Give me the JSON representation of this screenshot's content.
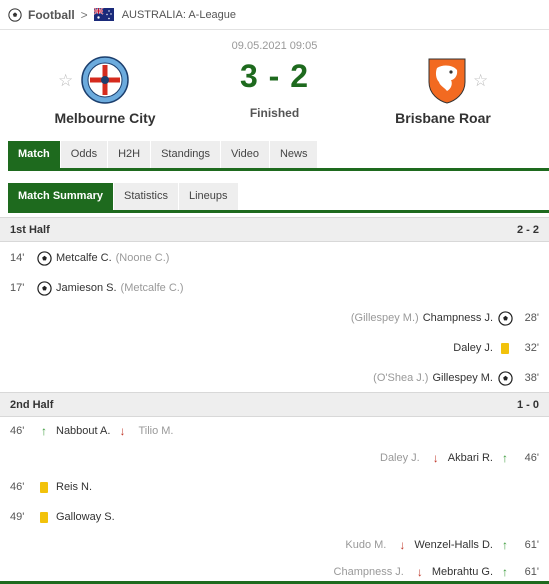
{
  "breadcrumb": {
    "sport": "Football",
    "separator": ">",
    "league": "AUSTRALIA: A-League"
  },
  "match": {
    "date": "09.05.2021 09:05",
    "score": "3 - 2",
    "status": "Finished",
    "home_team": "Melbourne City",
    "away_team": "Brisbane Roar",
    "favorite_glyph": "☆"
  },
  "main_tabs": [
    "Match",
    "Odds",
    "H2H",
    "Standings",
    "Video",
    "News"
  ],
  "sub_tabs": [
    "Match Summary",
    "Statistics",
    "Lineups"
  ],
  "first_half": {
    "label": "1st Half",
    "score": "2 - 2",
    "events": [
      {
        "side": "home",
        "minute": "14'",
        "type": "goal",
        "icon": "ball-icon",
        "player": "Metcalfe C.",
        "assist": "(Noone C.)"
      },
      {
        "side": "home",
        "minute": "17'",
        "type": "goal",
        "icon": "ball-icon",
        "player": "Jamieson S.",
        "assist": "(Metcalfe C.)"
      },
      {
        "side": "away",
        "minute": "28'",
        "type": "goal",
        "icon": "ball-icon",
        "player": "Champness J.",
        "assist": "(Gillespey M.)"
      },
      {
        "side": "away",
        "minute": "32'",
        "type": "yellow",
        "icon": "yellow-card-icon",
        "player": "Daley J."
      },
      {
        "side": "away",
        "minute": "38'",
        "type": "goal",
        "icon": "ball-icon",
        "player": "Gillespey M.",
        "assist": "(O'Shea J.)"
      }
    ]
  },
  "second_half": {
    "label": "2nd Half",
    "score": "1 - 0",
    "events": [
      {
        "side": "home",
        "minute": "46'",
        "type": "sub",
        "icon": "sub-in-arrow-icon",
        "player_in": "Nabbout A.",
        "arrow_out": "↓",
        "player_out": "Tilio M."
      },
      {
        "side": "away",
        "minute": "46'",
        "type": "sub",
        "icon": "sub-in-arrow-icon",
        "player_in": "Akbari R.",
        "arrow_out": "↓",
        "player_out": "Daley J."
      },
      {
        "side": "home",
        "minute": "46'",
        "type": "yellow",
        "icon": "yellow-card-icon",
        "player": "Reis N."
      },
      {
        "side": "home",
        "minute": "49'",
        "type": "yellow",
        "icon": "yellow-card-icon",
        "player": "Galloway S."
      },
      {
        "side": "away",
        "minute": "61'",
        "type": "sub",
        "icon": "sub-in-arrow-icon",
        "player_in": "Wenzel-Halls D.",
        "arrow_out": "↓",
        "player_out": "Kudo M."
      },
      {
        "side": "away",
        "minute": "61'",
        "type": "sub",
        "icon": "sub-in-arrow-icon",
        "player_in": "Mebrahtu G.",
        "arrow_out": "↓",
        "player_out": "Champness J."
      }
    ]
  },
  "glyphs": {
    "arrow_in": "↑",
    "arrow_out": "↓"
  },
  "colors": {
    "accent": "#1e6a1e",
    "score": "#1e6a1e",
    "tab_bg": "#eeeeee",
    "yellow_card": "#f2c20b",
    "sub_in": "#3a9a3a",
    "sub_out": "#c0392b"
  }
}
